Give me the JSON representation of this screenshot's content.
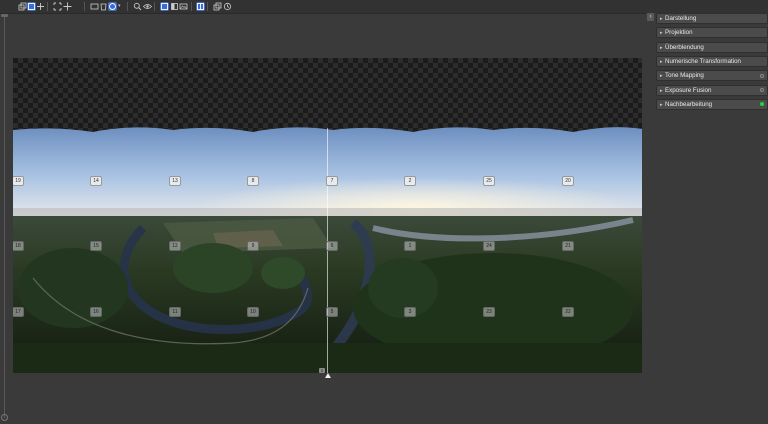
{
  "toolbar": {
    "buttons": [
      {
        "name": "layers-icon",
        "active": false
      },
      {
        "name": "preview-icon",
        "active": true
      },
      {
        "name": "layout-icon",
        "active": false
      },
      {
        "name": "fit-icon",
        "active": false
      },
      {
        "name": "crosshair-icon",
        "active": false
      },
      {
        "name": "rect-select-icon",
        "active": false
      },
      {
        "name": "trash-icon",
        "active": false
      },
      {
        "name": "mask-icon",
        "active": true
      },
      {
        "name": "search-icon",
        "active": false
      },
      {
        "name": "eye-icon",
        "active": false
      },
      {
        "name": "frame-icon",
        "active": true
      },
      {
        "name": "contrast-icon",
        "active": false
      },
      {
        "name": "image-icon",
        "active": false
      },
      {
        "name": "split-view-icon",
        "active": true
      },
      {
        "name": "copy-icon",
        "active": false
      },
      {
        "name": "history-icon",
        "active": false
      }
    ]
  },
  "panel": {
    "sections": [
      {
        "label": "Darstellung",
        "status": null
      },
      {
        "label": "Projektion",
        "status": null
      },
      {
        "label": "Überblendung",
        "status": null
      },
      {
        "label": "Numerische Transformation",
        "status": null
      },
      {
        "label": "Tone Mapping",
        "status": "gray"
      },
      {
        "label": "Exposure Fusion",
        "status": "gray"
      },
      {
        "label": "Nachbearbeitung",
        "status": "green"
      }
    ]
  },
  "canvas": {
    "image_labels": [
      {
        "text": "19",
        "row": "top"
      },
      {
        "text": "14",
        "row": "top"
      },
      {
        "text": "13",
        "row": "top"
      },
      {
        "text": "8",
        "row": "top"
      },
      {
        "text": "7",
        "row": "top"
      },
      {
        "text": "2",
        "row": "top"
      },
      {
        "text": "25",
        "row": "top"
      },
      {
        "text": "20",
        "row": "top"
      },
      {
        "text": "18",
        "row": "mid"
      },
      {
        "text": "15",
        "row": "mid"
      },
      {
        "text": "12",
        "row": "mid"
      },
      {
        "text": "9",
        "row": "mid"
      },
      {
        "text": "6",
        "row": "mid"
      },
      {
        "text": "1",
        "row": "mid"
      },
      {
        "text": "24",
        "row": "mid"
      },
      {
        "text": "21",
        "row": "mid"
      },
      {
        "text": "17",
        "row": "bot"
      },
      {
        "text": "16",
        "row": "bot"
      },
      {
        "text": "11",
        "row": "bot"
      },
      {
        "text": "10",
        "row": "bot"
      },
      {
        "text": "5",
        "row": "bot"
      },
      {
        "text": "3",
        "row": "bot"
      },
      {
        "text": "23",
        "row": "bot"
      },
      {
        "text": "22",
        "row": "bot"
      }
    ],
    "marker_label": "0"
  }
}
